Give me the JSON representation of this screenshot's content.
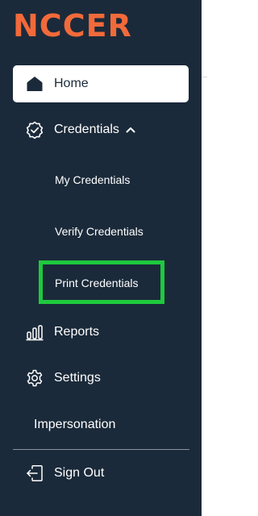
{
  "brand": {
    "logo_text": "NCCER",
    "color": "#f26a3a"
  },
  "nav": {
    "home": {
      "label": "Home",
      "icon": "home-icon"
    },
    "credentials": {
      "label": "Credentials",
      "icon": "badge-check-icon",
      "expanded": true,
      "children": [
        {
          "label": "My Credentials"
        },
        {
          "label": "Verify Credentials"
        },
        {
          "label": "Print Credentials"
        }
      ]
    },
    "reports": {
      "label": "Reports",
      "icon": "bar-chart-icon"
    },
    "settings": {
      "label": "Settings",
      "icon": "gear-icon"
    },
    "impersonation": {
      "label": "Impersonation"
    },
    "sign_out": {
      "label": "Sign Out",
      "icon": "sign-out-icon"
    }
  },
  "colors": {
    "sidebar_bg": "#1b2a3a",
    "highlight": "#1ec93e",
    "accent": "#f26a3a"
  }
}
